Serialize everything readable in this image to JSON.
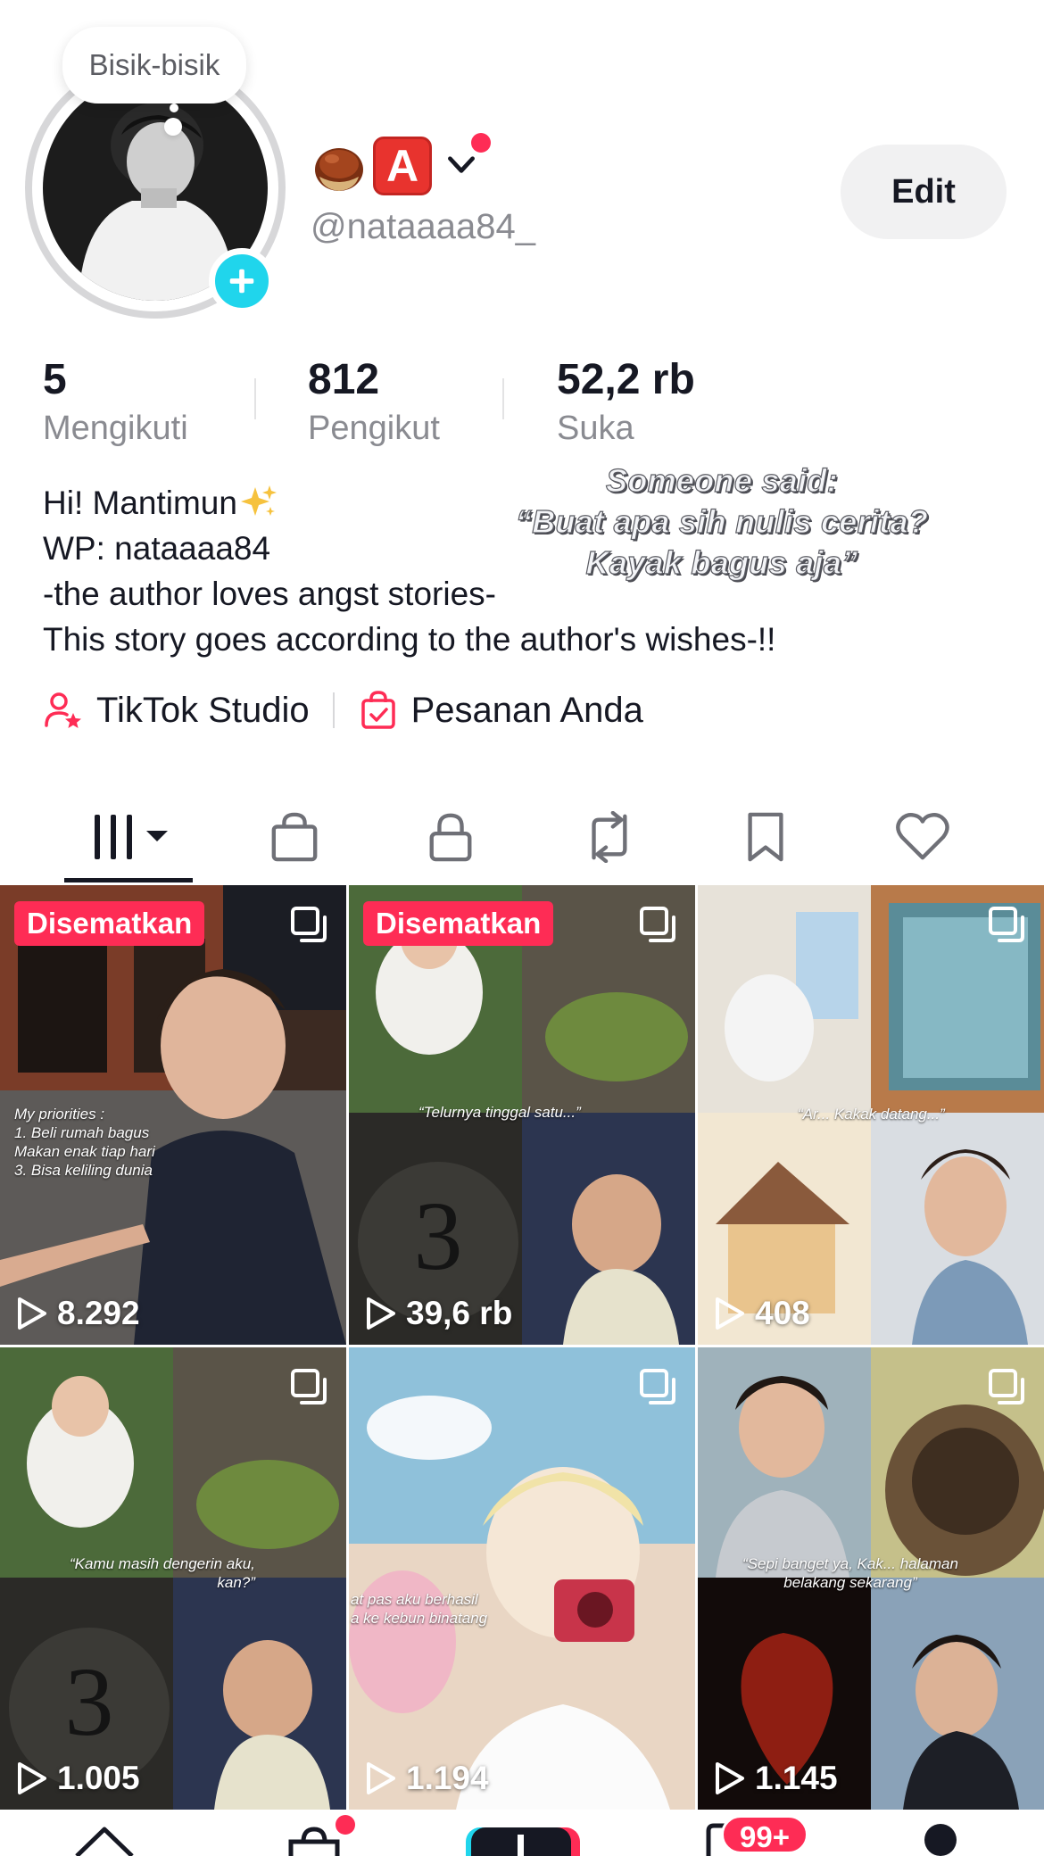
{
  "profile": {
    "whisper_label": "Bisik-bisik",
    "name_emoji": [
      "chestnut-emoji",
      "A-button-emoji"
    ],
    "name_letter": "A",
    "username": "@nataaaa84_",
    "edit_label": "Edit"
  },
  "stats": [
    {
      "value": "5",
      "label": "Mengikuti"
    },
    {
      "value": "812",
      "label": "Pengikut"
    },
    {
      "value": "52,2 rb",
      "label": "Suka"
    }
  ],
  "bio": {
    "lines": [
      "Hi! Mantimun",
      "WP: nataaaa84",
      "-the author loves angst stories-",
      "This story goes according to the author's wishes-!!"
    ],
    "quote": [
      "Someone said:",
      "“Buat apa sih nulis cerita?",
      "Kayak bagus aja”"
    ]
  },
  "links": {
    "studio": "TikTok Studio",
    "orders": "Pesanan Anda"
  },
  "tabs": [
    "videos-grid-icon",
    "shop-bag-icon",
    "lock-icon",
    "repost-icon",
    "bookmark-icon",
    "heart-icon"
  ],
  "videos": [
    {
      "pinned": "Disematkan",
      "views": "8.292",
      "caption": [
        "My priorities :",
        "1. Beli rumah bagus",
        "Makan enak tiap hari",
        "3. Bisa keliling dunia"
      ]
    },
    {
      "pinned": "Disematkan",
      "views": "39,6 rb",
      "caption": [
        "“Telurnya tinggal satu...”"
      ]
    },
    {
      "pinned": "",
      "views": "408",
      "caption": [
        "“Ar... Kakak datang...”"
      ]
    },
    {
      "pinned": "",
      "views": "1.005",
      "caption": [
        "“Kamu masih dengerin aku,",
        "kan?”"
      ]
    },
    {
      "pinned": "",
      "views": "1.194",
      "caption": [
        "at pas aku berhasil",
        "a ke kebun binatang"
      ]
    },
    {
      "pinned": "",
      "views": "1.145",
      "caption": [
        "“Sepi banget ya, Kak... halaman",
        "belakang sekarang”"
      ]
    }
  ],
  "bottom_nav": {
    "inbox_badge": "99+"
  },
  "colors": {
    "accent": "#fe2c55",
    "add_button": "#20d5ec",
    "muted_text": "#8a8b91"
  }
}
